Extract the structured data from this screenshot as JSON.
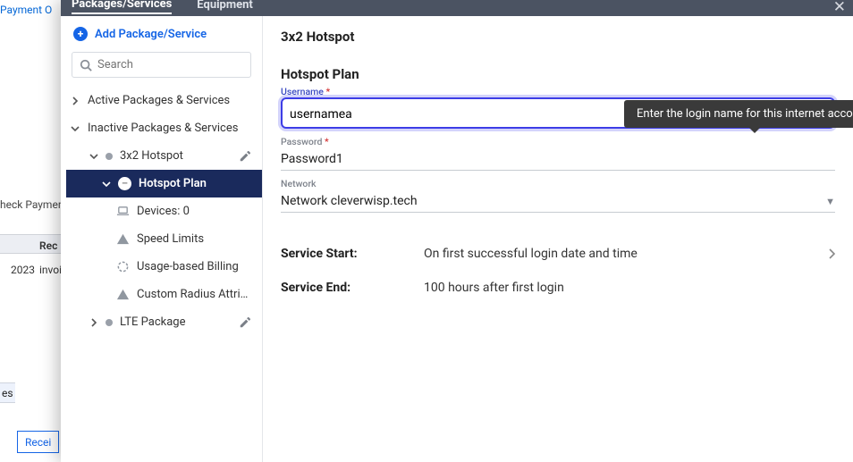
{
  "background": {
    "payment_o": "Payment O",
    "check_payment": "heck Paymer",
    "rec": "Rec",
    "year": "2023",
    "invo": "invoi",
    "es_tab": "es",
    "recei": "Recei"
  },
  "tabs": {
    "packages": "Packages/Services",
    "equipment": "Equipment"
  },
  "sidebar": {
    "add": "Add Package/Service",
    "search_placeholder": "Search",
    "active_label": "Active Packages & Services",
    "inactive_label": "Inactive Packages & Services",
    "items": {
      "hotspot_pkg": "3x2 Hotspot",
      "hotspot_plan": "Hotspot Plan",
      "devices": "Devices: 0",
      "speed_limits": "Speed Limits",
      "usage_billing": "Usage-based Billing",
      "custom_radius": "Custom Radius Attri…",
      "lte_pkg": "LTE Package"
    }
  },
  "main": {
    "title": "3x2 Hotspot",
    "section": "Hotspot Plan",
    "username_label": "Username",
    "username_value": "usernamea",
    "password_label": "Password",
    "password_value": "Password1",
    "network_label": "Network",
    "network_value": "Network cleverwisp.tech",
    "service_start_label": "Service Start:",
    "service_start_value": "On first successful login date and time",
    "service_end_label": "Service End:",
    "service_end_value": "100 hours after first login",
    "tooltip": "Enter the login name for this internet account."
  }
}
